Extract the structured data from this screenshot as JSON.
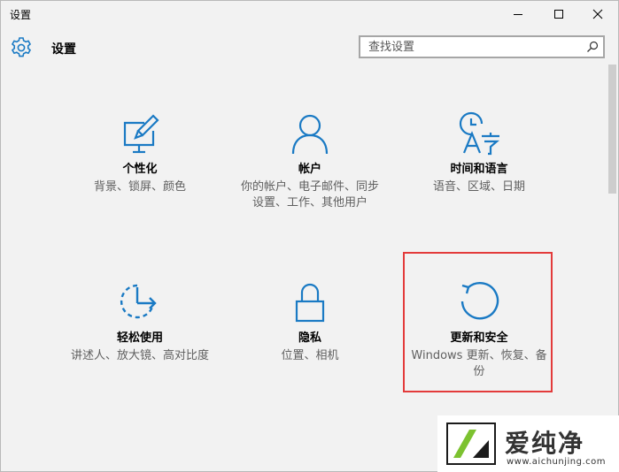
{
  "window": {
    "title": "设置"
  },
  "header": {
    "title": "设置",
    "icon": "gear-icon"
  },
  "search": {
    "placeholder": "查找设置",
    "icon": "search-icon"
  },
  "accent_color": "#1a7ac4",
  "tiles": [
    {
      "title": "个性化",
      "desc": "背景、锁屏、颜色",
      "icon": "personalization-icon"
    },
    {
      "title": "帐户",
      "desc": "你的帐户、电子邮件、同步设置、工作、其他用户",
      "icon": "accounts-icon"
    },
    {
      "title": "时间和语言",
      "desc": "语音、区域、日期",
      "icon": "time-language-icon"
    },
    {
      "title": "轻松使用",
      "desc": "讲述人、放大镜、高对比度",
      "icon": "ease-of-access-icon"
    },
    {
      "title": "隐私",
      "desc": "位置、相机",
      "icon": "privacy-lock-icon"
    },
    {
      "title": "更新和安全",
      "desc": "Windows 更新、恢复、备份",
      "icon": "update-security-icon"
    }
  ],
  "highlight_color": "#e33b3b",
  "watermark": {
    "text": "爱纯净",
    "url": "www.aichunjing.com"
  }
}
